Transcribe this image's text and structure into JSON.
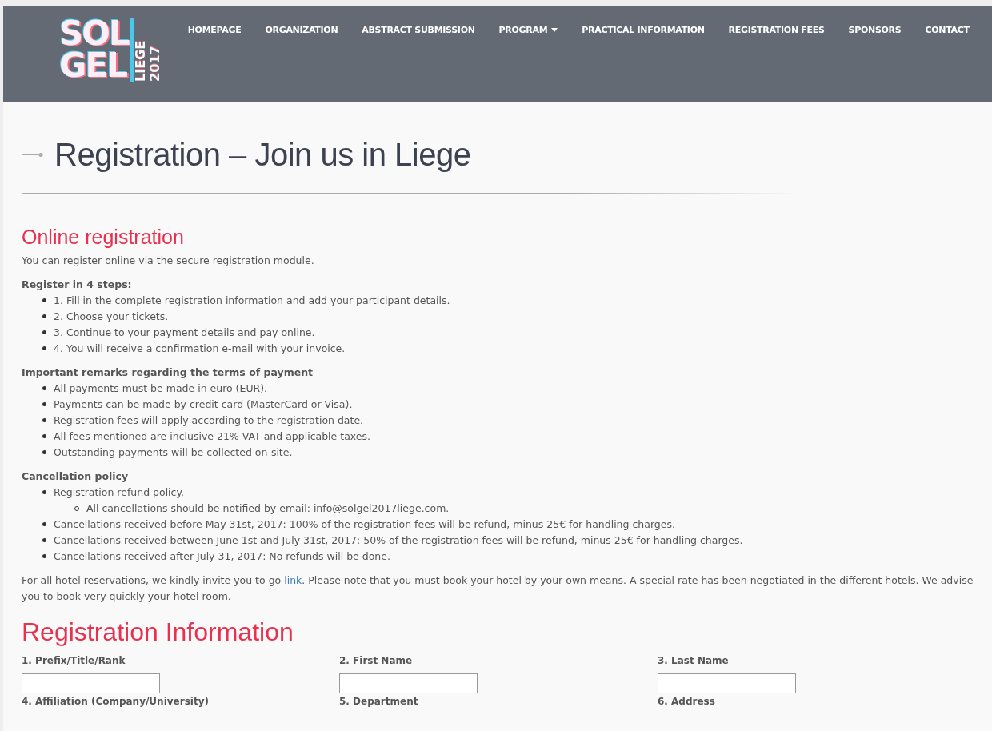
{
  "logo": {
    "line1": "SOL",
    "line2": "GEL",
    "side": "LIEGE 2017"
  },
  "nav": [
    {
      "label": "HOMEPAGE",
      "dropdown": false
    },
    {
      "label": "ORGANIZATION",
      "dropdown": false
    },
    {
      "label": "ABSTRACT SUBMISSION",
      "dropdown": false
    },
    {
      "label": "PROGRAM",
      "dropdown": true
    },
    {
      "label": "PRACTICAL INFORMATION",
      "dropdown": false
    },
    {
      "label": "REGISTRATION FEES",
      "dropdown": false
    },
    {
      "label": "SPONSORS",
      "dropdown": false
    },
    {
      "label": "CONTACT",
      "dropdown": false
    }
  ],
  "page_title": "Registration – Join us in Liege",
  "online": {
    "heading": "Online registration",
    "intro": "You can register online via the secure registration module.",
    "sections": [
      {
        "title": "Register in 4 steps:",
        "items": [
          {
            "text": "1. Fill in the complete registration information and add your participant details."
          },
          {
            "text": "2. Choose your tickets."
          },
          {
            "text": "3. Continue to your payment details and pay online."
          },
          {
            "text": "4. You will receive a confirmation e-mail with your invoice."
          }
        ]
      },
      {
        "title": "Important remarks regarding the terms of payment",
        "items": [
          {
            "text": "All payments must be made in euro (EUR)."
          },
          {
            "text": "Payments can be made by credit card (MasterCard or Visa)."
          },
          {
            "text": "Registration fees will apply according to the registration date."
          },
          {
            "text": "All fees mentioned are inclusive 21% VAT and applicable taxes."
          },
          {
            "text": "Outstanding payments will be collected on-site."
          }
        ]
      },
      {
        "title": "Cancellation policy",
        "items": [
          {
            "text": "Registration refund policy.",
            "children": [
              {
                "text": "All cancellations should be notified by email: info@solgel2017liege.com."
              }
            ]
          },
          {
            "text": "Cancellations received before May 31st, 2017: 100% of the registration fees will be refund, minus 25€ for handling charges."
          },
          {
            "text": "Cancellations received between June 1st and July 31st, 2017: 50% of the registration fees will be refund, minus 25€ for handling charges."
          },
          {
            "text": "Cancellations received after July 31, 2017: No refunds will be done."
          }
        ]
      }
    ],
    "hotel": {
      "before": "For all hotel reservations, we kindly invite you to go ",
      "link": "link",
      "after": ". Please note that you must book your hotel by your own means. A special rate has been negotiated in the different hotels. We advise you to book very quickly your hotel room."
    }
  },
  "form": {
    "heading": "Registration Information",
    "fields": [
      {
        "label": "1. Prefix/Title/Rank",
        "input_visible": true
      },
      {
        "label": "2. First Name",
        "input_visible": true
      },
      {
        "label": "3. Last Name",
        "input_visible": true
      },
      {
        "label": "4. Affiliation (Company/University)",
        "input_visible": false
      },
      {
        "label": "5. Department",
        "input_visible": false
      },
      {
        "label": "6. Address",
        "input_visible": false
      }
    ]
  }
}
